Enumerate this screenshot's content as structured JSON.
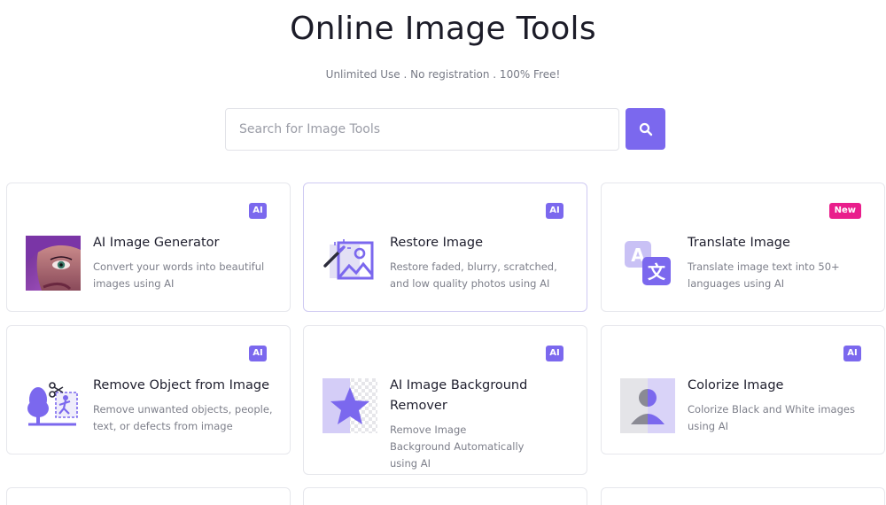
{
  "header": {
    "title": "Online Image Tools",
    "subtitle": "Unlimited Use . No registration . 100% Free!"
  },
  "search": {
    "placeholder": "Search for Image Tools",
    "value": "",
    "button_icon": "search-icon"
  },
  "colors": {
    "accent": "#7b68ee",
    "badge_new": "#e91e8c"
  },
  "tools": [
    {
      "title": "AI Image Generator",
      "description": "Convert your words into beautiful images using AI",
      "badge": "AI",
      "icon": "ai-portrait-thumbnail"
    },
    {
      "title": "Restore Image",
      "description": "Restore faded, blurry, scratched, and low quality photos using AI",
      "badge": "AI",
      "icon": "magic-wand-image-icon"
    },
    {
      "title": "Translate Image",
      "description": "Translate image text into 50+ languages using AI",
      "badge": "New",
      "icon": "translate-icon"
    },
    {
      "title": "Remove Object from Image",
      "description": "Remove unwanted objects, people, text, or defects from image",
      "badge": "AI",
      "icon": "remove-object-icon"
    },
    {
      "title": "AI Image Background Remover",
      "description": "Remove Image Background Automatically using AI",
      "badge": "AI",
      "icon": "background-remover-icon"
    },
    {
      "title": "Colorize Image",
      "description": "Colorize Black and White images using AI",
      "badge": "AI",
      "icon": "colorize-person-icon"
    }
  ]
}
